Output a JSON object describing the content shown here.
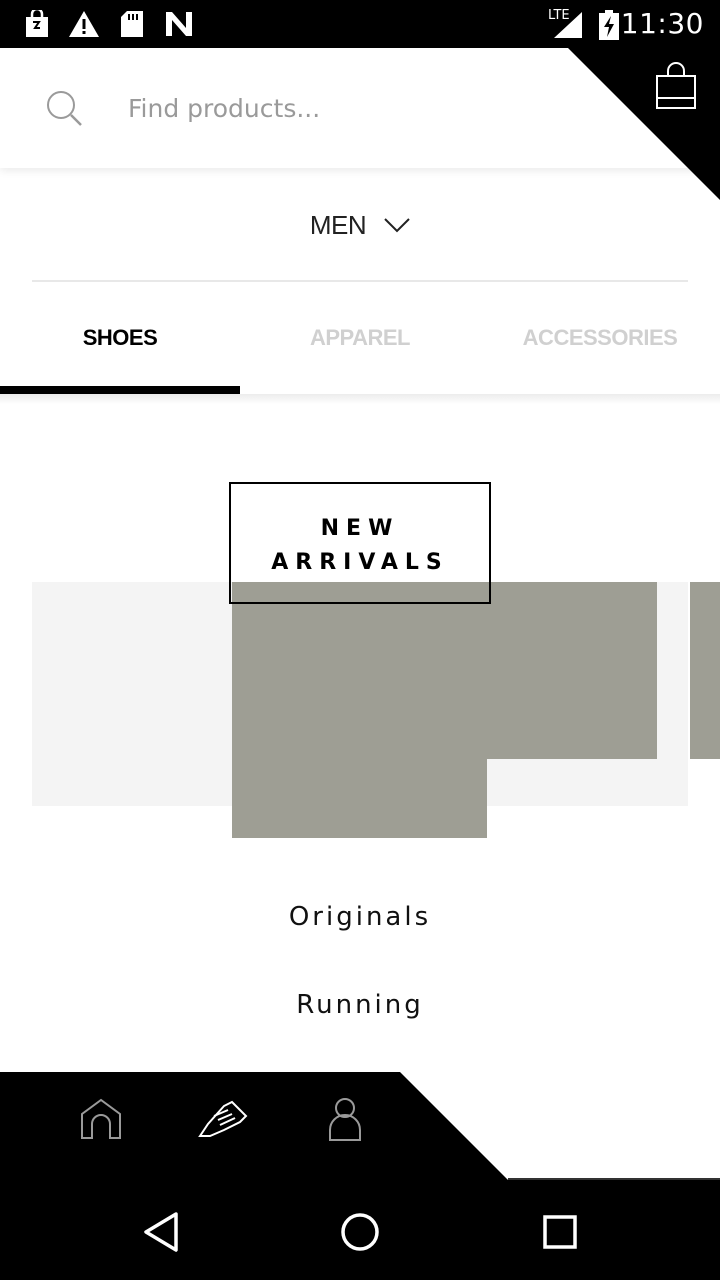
{
  "status_bar": {
    "time": "11:30",
    "network": "LTE",
    "icons": [
      "shop-bag-notification-icon",
      "warning-icon",
      "sd-card-icon",
      "n-logo-icon",
      "signal-icon",
      "battery-charging-icon"
    ]
  },
  "search": {
    "placeholder": "Find products..."
  },
  "header": {
    "cart_icon": "shopping-bag-icon"
  },
  "gender_selector": {
    "label": "MEN",
    "icon": "chevron-down-icon"
  },
  "tabs": [
    {
      "label": "SHOES",
      "active": true
    },
    {
      "label": "APPAREL",
      "active": false
    },
    {
      "label": "ACCESSORIES",
      "active": false
    }
  ],
  "carousel": {
    "badge_line1": "NEW",
    "badge_line2": "ARRIVALS",
    "card_color": "#9e9e94"
  },
  "categories": [
    {
      "label": "Originals"
    },
    {
      "label": "Running"
    }
  ],
  "bottom_nav": {
    "items": [
      "home-icon",
      "shoe-icon",
      "profile-icon"
    ],
    "active": "shoe-icon"
  },
  "system_nav": {
    "items": [
      "back-icon",
      "home-circle-icon",
      "recents-icon"
    ]
  },
  "colors": {
    "accent": "#000000",
    "inactive_tab": "#d0d0d0",
    "placeholder": "#9a9a9a"
  }
}
